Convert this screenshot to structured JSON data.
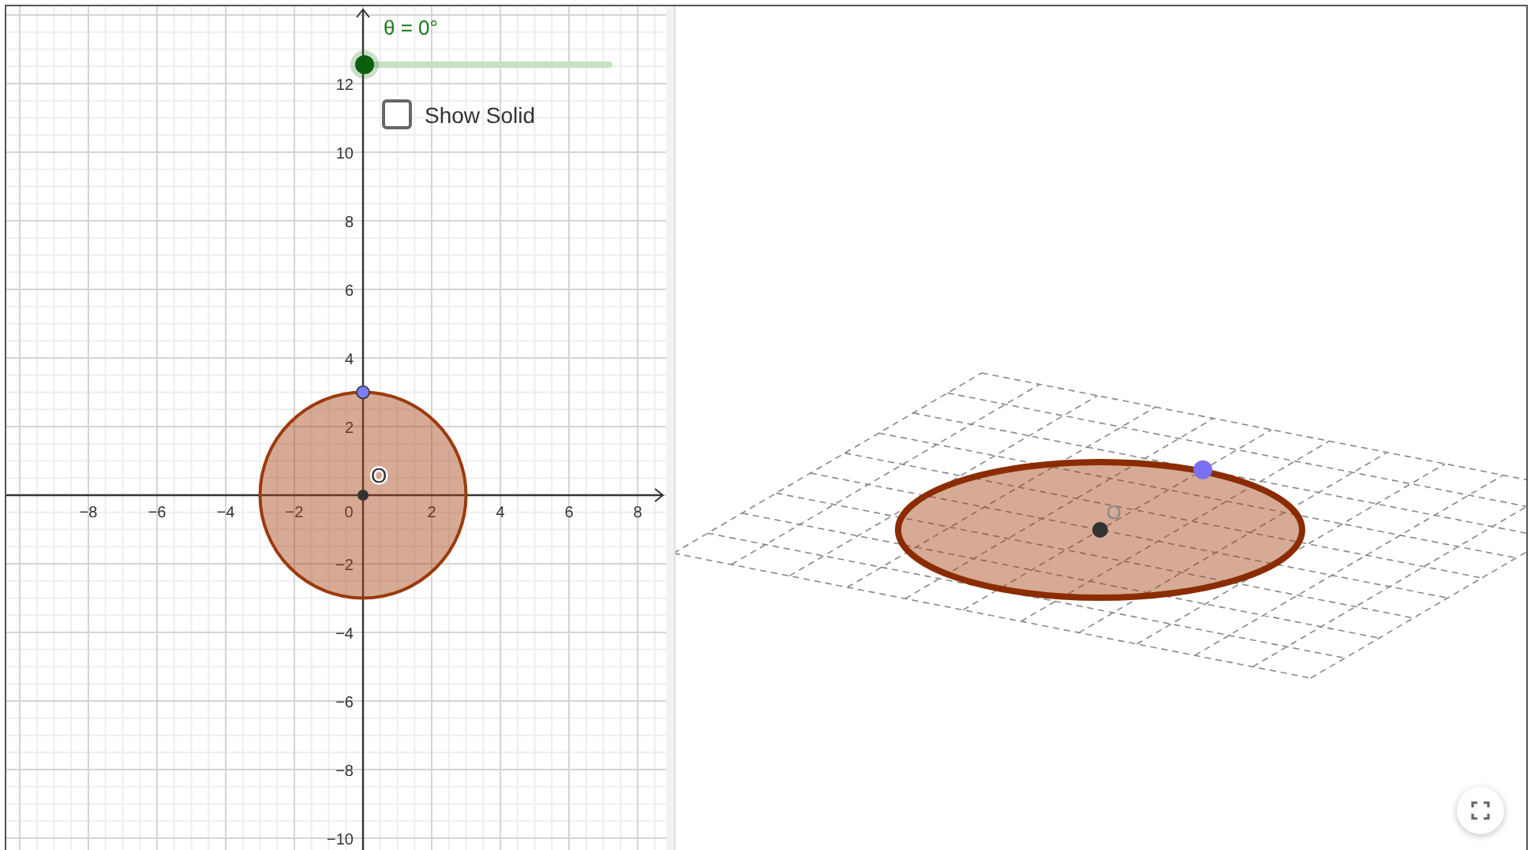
{
  "slider": {
    "label": "θ = 0°",
    "level": 0
  },
  "checkbox": {
    "label": "Show Solid",
    "checked": false
  },
  "graph_2d": {
    "x_labels": [
      "−8",
      "−6",
      "−4",
      "−2",
      "0",
      "2",
      "4",
      "6",
      "8"
    ],
    "y_labels": [
      "12",
      "10",
      "8",
      "6",
      "4",
      "2",
      "−2",
      "−4",
      "−6",
      "−8",
      "−10"
    ],
    "point_label": "O"
  },
  "view_3d": {
    "point_label": "O"
  }
}
